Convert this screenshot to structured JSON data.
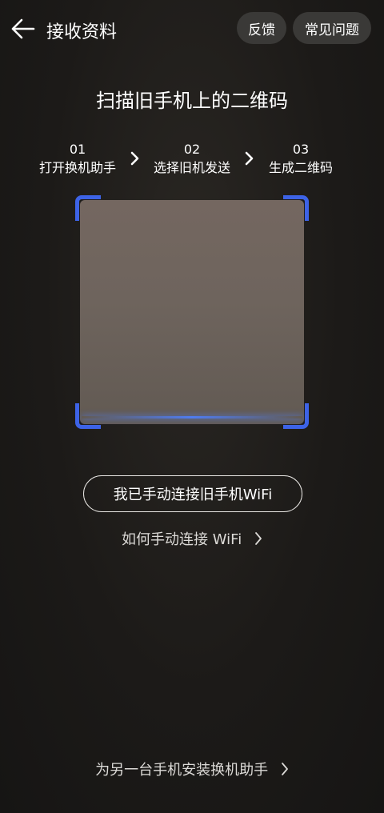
{
  "header": {
    "title": "接收资料",
    "back_icon": "arrow-left-icon",
    "feedback_label": "反馈",
    "faq_label": "常见问题"
  },
  "main": {
    "heading": "扫描旧手机上的二维码",
    "steps": [
      {
        "num": "01",
        "label": "打开换机助手"
      },
      {
        "num": "02",
        "label": "选择旧机发送"
      },
      {
        "num": "03",
        "label": "生成二维码"
      }
    ],
    "step_separator_icon": "chevron-right-icon",
    "scanner_accent_color": "#3d63e6",
    "manual_wifi_button": "我已手动连接旧手机WiFi",
    "howto_link": "如何手动连接 WiFi",
    "install_link": "为另一台手机安装换机助手"
  }
}
